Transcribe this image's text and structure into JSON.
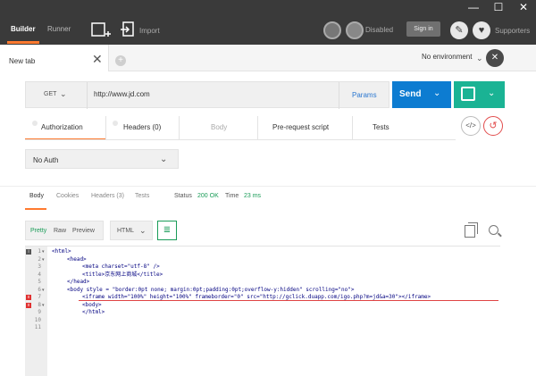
{
  "window": {
    "minimize": "—",
    "maximize": "☐",
    "close": "✕"
  },
  "topbar": {
    "tabs": [
      {
        "label": "Builder",
        "active": true
      },
      {
        "label": "Runner",
        "active": false
      }
    ],
    "import_label": "Import",
    "disabled_label": "Disabled",
    "signin_label": "Sign in",
    "supporters_label": "Supporters"
  },
  "tab": {
    "title": "New tab",
    "close": "✕",
    "add": "+"
  },
  "environment": {
    "label": "No environment",
    "btn": "✕"
  },
  "request": {
    "method": "GET",
    "url": "http://www.jd.com",
    "params_label": "Params",
    "send_label": "Send"
  },
  "request_tabs": [
    {
      "label": "Authorization",
      "active": true,
      "muted": false
    },
    {
      "label": "Headers (0)",
      "active": false,
      "muted": false
    },
    {
      "label": "Body",
      "active": false,
      "muted": true
    },
    {
      "label": "Pre-request script",
      "active": false,
      "muted": false
    },
    {
      "label": "Tests",
      "active": false,
      "muted": false
    }
  ],
  "code_btn": "</>",
  "history_btn": "↺",
  "auth": {
    "type": "No Auth"
  },
  "response": {
    "tabs": [
      {
        "label": "Body",
        "active": true
      },
      {
        "label": "Cookies",
        "active": false
      },
      {
        "label": "Headers (3)",
        "active": false
      },
      {
        "label": "Tests",
        "active": false
      }
    ],
    "status_label": "Status",
    "status_value": "200 OK",
    "time_label": "Time",
    "time_value": "23 ms",
    "formats": [
      "Pretty",
      "Raw",
      "Preview"
    ],
    "active_format": "Pretty",
    "language": "HTML"
  },
  "editor": {
    "lines": [
      {
        "n": "1",
        "fold": "▾",
        "mark": "i",
        "indent": 0,
        "code": "<html>"
      },
      {
        "n": "2",
        "fold": "▾",
        "mark": "",
        "indent": 1,
        "code": "<head>"
      },
      {
        "n": "3",
        "fold": "",
        "mark": "",
        "indent": 2,
        "code": "<meta charset=\"utf-8\" />"
      },
      {
        "n": "4",
        "fold": "",
        "mark": "",
        "indent": 2,
        "code": "<title>京东网上商城</title>"
      },
      {
        "n": "5",
        "fold": "",
        "mark": "",
        "indent": 1,
        "code": "</head>"
      },
      {
        "n": "6",
        "fold": "▾",
        "mark": "",
        "indent": 1,
        "code": "<body style = \"border:0pt none; margin:0pt;padding:0pt;overflow-y:hidden\" scrolling=\"no\">"
      },
      {
        "n": "7",
        "fold": "",
        "mark": "x",
        "indent": 2,
        "code": "<iframe width=\"100%\" height=\"100%\" frameborder=\"0\" src=\"http://gclick.duapp.com/igo.php?m=jd&a=30\"></iframe>"
      },
      {
        "n": "8",
        "fold": "▾",
        "mark": "x",
        "indent": 2,
        "code": "<body>"
      },
      {
        "n": "9",
        "fold": "",
        "mark": "",
        "indent": 2,
        "code": "</html>"
      },
      {
        "n": "10",
        "fold": "",
        "mark": "",
        "indent": 0,
        "code": ""
      },
      {
        "n": "11",
        "fold": "",
        "mark": "",
        "indent": 0,
        "code": ""
      }
    ]
  }
}
